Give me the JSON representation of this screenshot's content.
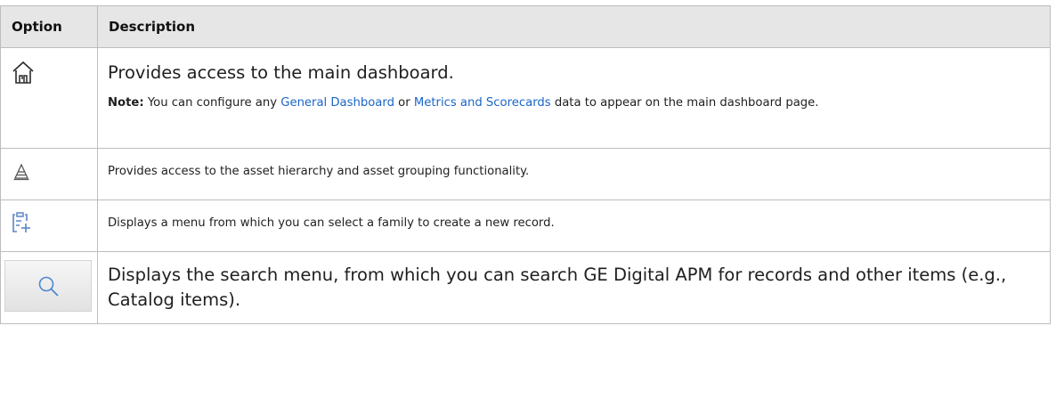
{
  "table": {
    "headers": {
      "option": "Option",
      "description": "Description"
    },
    "rows": [
      {
        "icon": "home-icon",
        "description": "Provides access to the main dashboard.",
        "note": {
          "label": "Note:",
          "text_before": "You can configure any",
          "link1": "General Dashboard",
          "text_middle": "or",
          "link2": "Metrics and Scorecards",
          "text_after": "data to appear on the main dashboard page."
        }
      },
      {
        "icon": "asset-hierarchy-icon",
        "description": "Provides access to the asset hierarchy and asset grouping functionality."
      },
      {
        "icon": "new-record-icon",
        "description": "Displays a menu from which you can select a family to create a new record."
      },
      {
        "icon": "search-icon",
        "description": "Displays the search menu, from which you can search GE Digital APM for records and other items (e.g., Catalog items)."
      }
    ]
  },
  "colors": {
    "link": "#1a66c8",
    "icon_blue": "#5a86c8",
    "header_bg": "#e6e6e6",
    "border": "#bdbdbd"
  }
}
